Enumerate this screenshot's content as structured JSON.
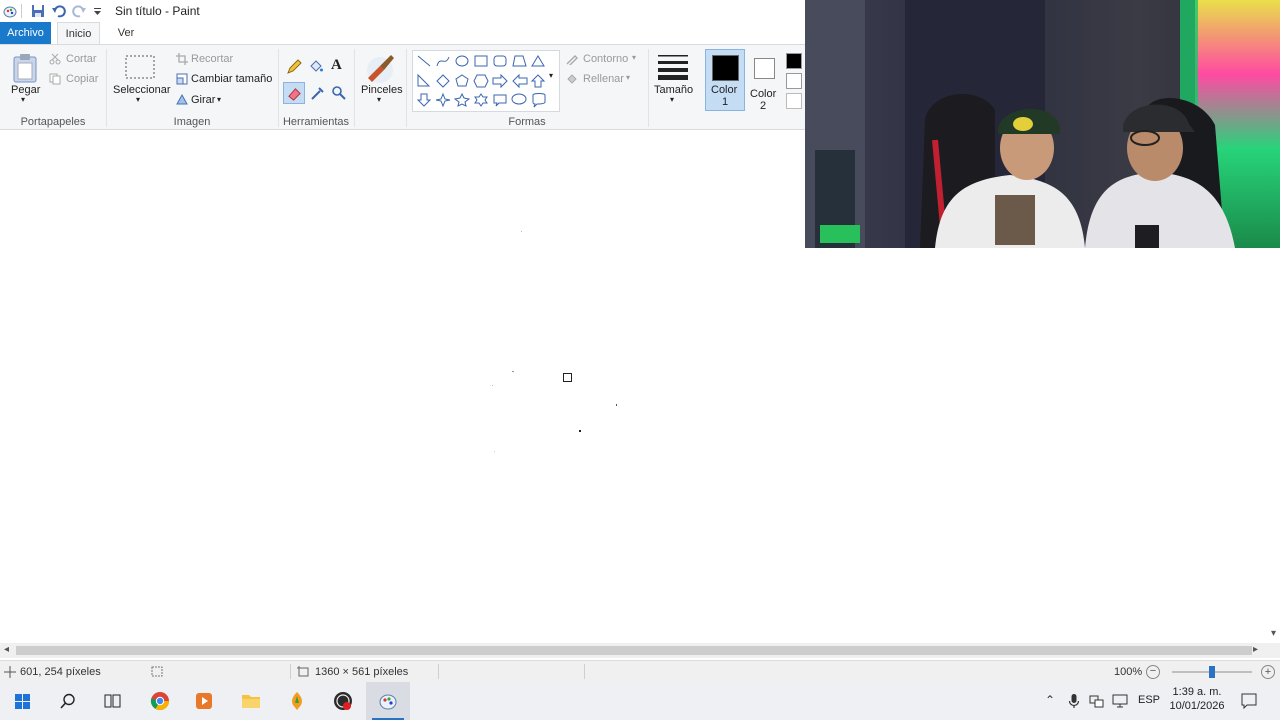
{
  "window": {
    "title": "Sin título - Paint"
  },
  "tabs": [
    {
      "label": "Archivo"
    },
    {
      "label": "Inicio"
    },
    {
      "label": "Ver"
    }
  ],
  "ribbon": {
    "clipboard": {
      "paste": "Pegar",
      "cut": "Cortar",
      "copy": "Copiar",
      "group": "Portapapeles"
    },
    "image": {
      "select": "Seleccionar",
      "crop": "Recortar",
      "resize": "Cambiar tamaño",
      "rotate": "Girar",
      "group": "Imagen"
    },
    "tools": {
      "group": "Herramientas"
    },
    "brushes": {
      "label": "Pinceles"
    },
    "shapes": {
      "outline": "Contorno",
      "fill": "Rellenar",
      "group": "Formas"
    },
    "size": {
      "label": "Tamaño"
    },
    "colors": {
      "color1_label": "Color",
      "color1_num": "1",
      "color2_label": "Color",
      "color2_num": "2",
      "color1": "#000000",
      "color2": "#ffffff"
    }
  },
  "status": {
    "cursor_pos": "601, 254 píxeles",
    "canvas_size": "1360 × 561 píxeles",
    "zoom": "100%",
    "zoom_fraction": 0.5
  },
  "taskbar": {
    "lang": "ESP",
    "time": "1:39 a. m.",
    "date": "10/01/2026"
  },
  "accent": "#1979ca"
}
